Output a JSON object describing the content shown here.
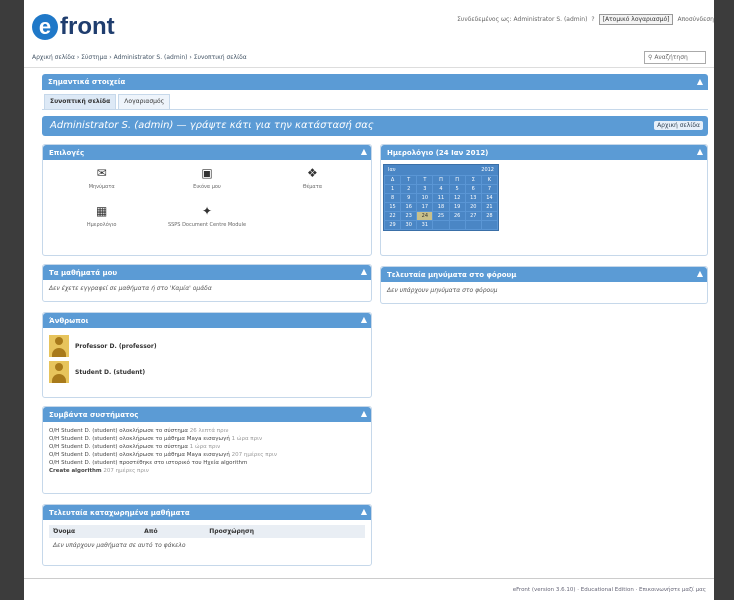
{
  "header": {
    "logo_letter": "e",
    "logo_text": "front",
    "user_text": "Συνδεδεμένος ως: Administrator S. (admin)",
    "role_select": "[Ατομικό λογαριασμό]",
    "logout": "Αποσύνδεση"
  },
  "breadcrumb": "Αρχική σελίδα › Σύστημα › Administrator S. (admin) › Συνοπτική σελίδα",
  "search_placeholder": "Αναζήτηση",
  "important_bar": "Σημαντικά στοιχεία",
  "tabs": [
    {
      "label": "Συνοπτική σελίδα"
    },
    {
      "label": "Λογαριασμός"
    }
  ],
  "title_bar": {
    "text": "Administrator S. (admin) — γράψτε κάτι για την κατάστασή σας",
    "home_button": "Αρχική σελίδα"
  },
  "panels": {
    "options": {
      "title": "Επιλογές",
      "items": [
        {
          "label": "Μηνύματα",
          "icon": "mail-icon"
        },
        {
          "label": "Εικόνα μου",
          "icon": "image-icon"
        },
        {
          "label": "Θέματα",
          "icon": "forum-icon"
        },
        {
          "label": "Ημερολόγιο",
          "icon": "calendar-icon"
        },
        {
          "label": "SSPS Document Centre Module",
          "icon": "ssps-icon"
        }
      ]
    },
    "calendar": {
      "title": "Ημερολόγιο (24 Ιαν 2012)",
      "month": "Ιαν",
      "year": "2012",
      "weekdays": [
        "Δ",
        "Τ",
        "Τ",
        "Π",
        "Π",
        "Σ",
        "Κ"
      ],
      "weeks": [
        [
          "1",
          "2",
          "3",
          "4",
          "5",
          "6",
          "7"
        ],
        [
          "8",
          "9",
          "10",
          "11",
          "12",
          "13",
          "14"
        ],
        [
          "15",
          "16",
          "17",
          "18",
          "19",
          "20",
          "21"
        ],
        [
          "22",
          "23",
          "24",
          "25",
          "26",
          "27",
          "28"
        ],
        [
          "29",
          "30",
          "31",
          "",
          "",
          "",
          ""
        ]
      ],
      "today": "24"
    },
    "my_lessons": {
      "title": "Τα μαθήματά μου",
      "empty": "Δεν έχετε εγγραφεί σε μαθήματα ή στο 'Καμία' ομάδα"
    },
    "forum": {
      "title": "Τελευταία μηνύματα στο φόρουμ",
      "empty": "Δεν υπάρχουν μηνύματα στο φόρουμ"
    },
    "people": {
      "title": "Άνθρωποι",
      "list": [
        {
          "name": "Professor D. (professor)"
        },
        {
          "name": "Student D. (student)"
        }
      ]
    },
    "events": {
      "title": "Συμβάντα συστήματος",
      "lines": [
        {
          "text": "Ο/Η Student D. (student) ολοκλήρωσε το σύστημα",
          "time": "26 λεπτά πριν"
        },
        {
          "text": "Ο/Η Student D. (student) ολοκλήρωσε το μάθημα Maya εισαγωγή",
          "time": "1 ώρα πριν"
        },
        {
          "text": "Ο/Η Student D. (student) ολοκλήρωσε το σύστημα",
          "time": "1 ώρα πριν"
        },
        {
          "text": "Ο/Η Student D. (student) ολοκλήρωσε το μάθημα Maya εισαγωγή",
          "time": "207 ημέρες πριν"
        },
        {
          "text": "Ο/Η Student D. (student) προστέθηκε στο ιστορικό του Ηχεία algorithm",
          "time": ""
        },
        {
          "text": "Create algorithm",
          "time": "207 ημέρες πριν"
        }
      ]
    },
    "recent_lessons": {
      "title": "Τελευταία καταχωρημένα μαθήματα",
      "headers": [
        "Όνομα",
        "Από",
        "Προσχώρηση"
      ],
      "empty": "Δεν υπάρχουν μαθήματα σε αυτό το φάκελο"
    }
  },
  "footer": "eFront (version 3.6.10) · Educational Edition · Επικοινωνήστε μαζί μας"
}
